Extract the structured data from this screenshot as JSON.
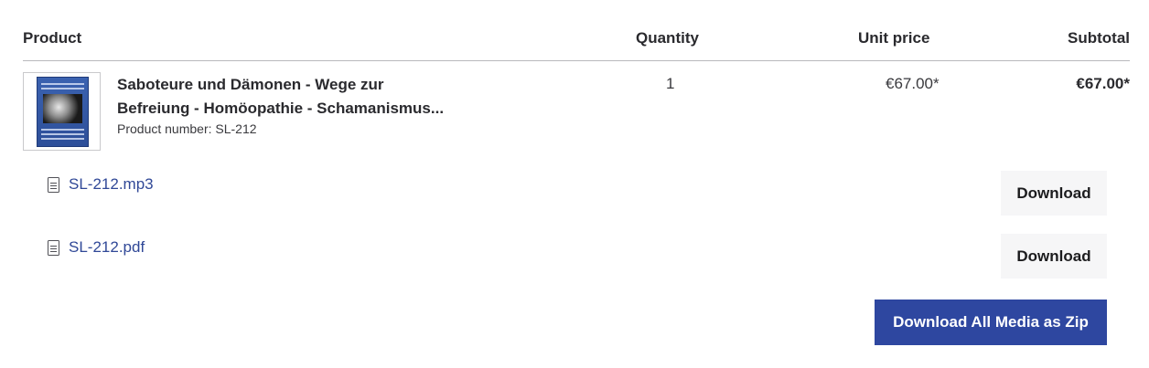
{
  "table": {
    "headers": {
      "product": "Product",
      "quantity": "Quantity",
      "unit_price": "Unit price",
      "subtotal": "Subtotal"
    }
  },
  "line_item": {
    "name_line1": "Saboteure und Dämonen - Wege zur",
    "name_line2": "Befreiung - Homöopathie - Schamanismus...",
    "product_number": "Product number: SL-212",
    "quantity": "1",
    "unit_price": "€67.00*",
    "subtotal": "€67.00*",
    "thumbnail_icon": "book-cover-image"
  },
  "downloads": {
    "files": [
      {
        "name": "SL-212.mp3",
        "icon": "document-icon",
        "button_label": "Download"
      },
      {
        "name": "SL-212.pdf",
        "icon": "document-icon",
        "button_label": "Download"
      }
    ],
    "download_all_label": "Download All Media as Zip"
  },
  "colors": {
    "primary": "#2e47a0",
    "link": "#304897",
    "button_light_bg": "#f6f6f7",
    "divider": "#b9b9bd"
  }
}
